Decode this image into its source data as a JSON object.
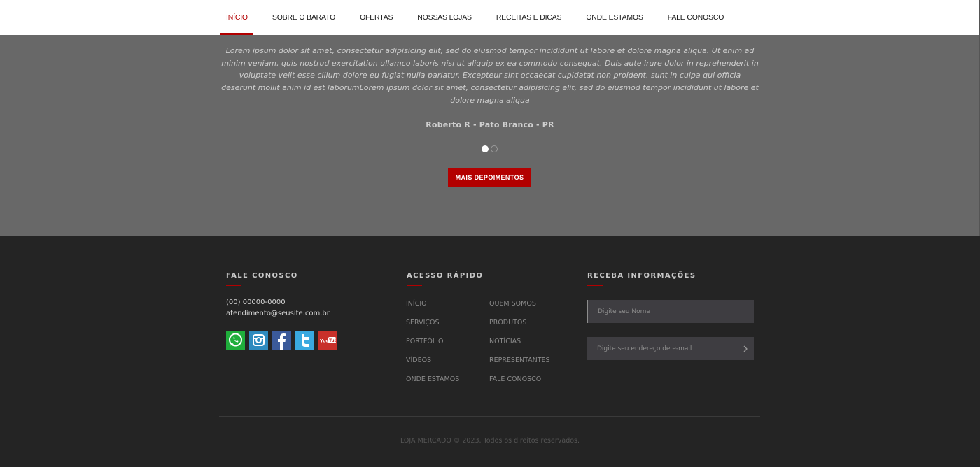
{
  "nav": {
    "items": [
      {
        "label": "INÍCIO",
        "active": true
      },
      {
        "label": "SOBRE O BARATO",
        "active": false
      },
      {
        "label": "OFERTAS",
        "active": false
      },
      {
        "label": "NOSSAS LOJAS",
        "active": false
      },
      {
        "label": "RECEITAS E DICAS",
        "active": false
      },
      {
        "label": "ONDE ESTAMOS",
        "active": false
      },
      {
        "label": "FALE CONOSCO",
        "active": false
      }
    ]
  },
  "testimonial": {
    "quote": "Lorem ipsum dolor sit amet, consectetur adipisicing elit, sed do eiusmod tempor incididunt ut labore et dolore magna aliqua. Ut enim ad minim veniam, quis nostrud exercitation ullamco laboris nisi ut aliquip ex ea commodo consequat. Duis aute irure dolor in reprehenderit in voluptate velit esse cillum dolore eu fugiat nulla pariatur. Excepteur sint occaecat cupidatat non proident, sunt in culpa qui officia deserunt mollit anim id est laborumLorem ipsum dolor sit amet, consectetur adipisicing elit, sed do eiusmod tempor incididunt ut labore et dolore magna aliqua",
    "author": "Roberto R - Pato Branco - PR",
    "active_slide": 1,
    "slide_count": 2,
    "more_label": "MAIS DEPOIMENTOS"
  },
  "footer": {
    "contact": {
      "title": "FALE CONOSCO",
      "phone": "(00) 00000-0000",
      "email": "atendimento@seusite.com.br",
      "socials": [
        "whatsapp-icon",
        "instagram-icon",
        "facebook-icon",
        "twitter-icon",
        "youtube-icon"
      ]
    },
    "quick_access": {
      "title": "ACESSO RÁPIDO",
      "links": [
        "INÍCIO",
        "QUEM SOMOS",
        "SERVIÇOS",
        "PRODUTOS",
        "PORTFÓLIO",
        "NOTÍCIAS",
        "VÍDEOS",
        "REPRESENTANTES",
        "ONDE ESTAMOS",
        "FALE CONOSCO"
      ]
    },
    "newsletter": {
      "title": "RECEBA INFORMAÇÕES",
      "name_placeholder": "Digite seu Nome",
      "email_placeholder": "Digite seu endereço de e-mail"
    },
    "copyright": "LOJA MERCADO © 2023. Todos os direitos reservados."
  },
  "colors": {
    "accent": "#b30000",
    "testimonial_bg": "#686868",
    "footer_bg": "#242424",
    "input_bg": "#3e3d41"
  }
}
